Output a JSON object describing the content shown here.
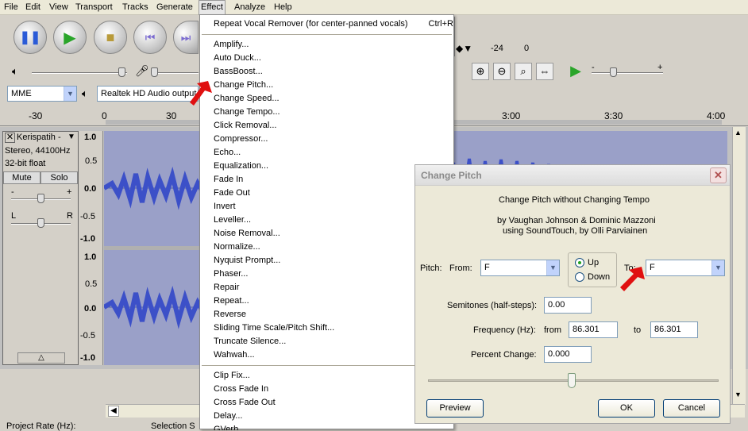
{
  "menubar": {
    "items": [
      "File",
      "Edit",
      "View",
      "Transport",
      "Tracks",
      "Generate",
      "Effect",
      "Analyze",
      "Help"
    ]
  },
  "meter": {
    "db_label_1": "-24",
    "db_label_2": "0"
  },
  "device_toolbar": {
    "host": "MME",
    "output_device": "Realtek HD Audio output"
  },
  "ruler": {
    "labels": [
      "-30",
      "0",
      "30",
      "3:00",
      "3:30",
      "4:00"
    ]
  },
  "track": {
    "name": "Kerispatih -",
    "info_line_1": "Stereo, 44100Hz",
    "info_line_2": "32-bit float",
    "mute_label": "Mute",
    "solo_label": "Solo",
    "gain_minus": "-",
    "gain_plus": "+",
    "pan_left": "L",
    "pan_right": "R",
    "scale_top": [
      "1.0",
      "0.5",
      "0.0",
      "-0.5",
      "-1.0"
    ],
    "scale_bottom": [
      "1.0",
      "0.5",
      "0.0",
      "-0.5",
      "-1.0"
    ]
  },
  "status": {
    "project_rate": "Project Rate (Hz):",
    "selection": "Selection S"
  },
  "effect_menu": {
    "repeat_label": "Repeat Vocal Remover (for center-panned vocals)",
    "repeat_shortcut": "Ctrl+R",
    "items": [
      "Amplify...",
      "Auto Duck...",
      "BassBoost...",
      "Change Pitch...",
      "Change Speed...",
      "Change Tempo...",
      "Click Removal...",
      "Compressor...",
      "Echo...",
      "Equalization...",
      "Fade In",
      "Fade Out",
      "Invert",
      "Leveller...",
      "Noise Removal...",
      "Normalize...",
      "Nyquist Prompt...",
      "Phaser...",
      "Repair",
      "Repeat...",
      "Reverse",
      "Sliding Time Scale/Pitch Shift...",
      "Truncate Silence...",
      "Wahwah..."
    ],
    "plugin_items": [
      "Clip Fix...",
      "Cross Fade In",
      "Cross Fade Out",
      "Delay...",
      "GVerb..."
    ]
  },
  "dialog": {
    "title": "Change Pitch",
    "close_glyph": "✕",
    "heading": "Change Pitch without Changing Tempo",
    "credits_1": "by Vaughan Johnson & Dominic Mazzoni",
    "credits_2": "using SoundTouch, by Olli Parviainen",
    "pitch_label": "Pitch:",
    "from_label": "From:",
    "from_value": "F",
    "up_label": "Up",
    "down_label": "Down",
    "to_label": "To:",
    "to_value": "F",
    "semitones_label": "Semitones (half-steps):",
    "semitones_value": "0.00",
    "frequency_label": "Frequency (Hz):",
    "freq_from_label": "from",
    "freq_from_value": "86.301",
    "freq_to_label": "to",
    "freq_to_value": "86.301",
    "percent_label": "Percent Change:",
    "percent_value": "0.000",
    "preview_label": "Preview",
    "ok_label": "OK",
    "cancel_label": "Cancel"
  },
  "colors": {
    "waveform": "#3c50c8",
    "arrow": "#e01010",
    "menu_bg": "#ece9d8"
  }
}
